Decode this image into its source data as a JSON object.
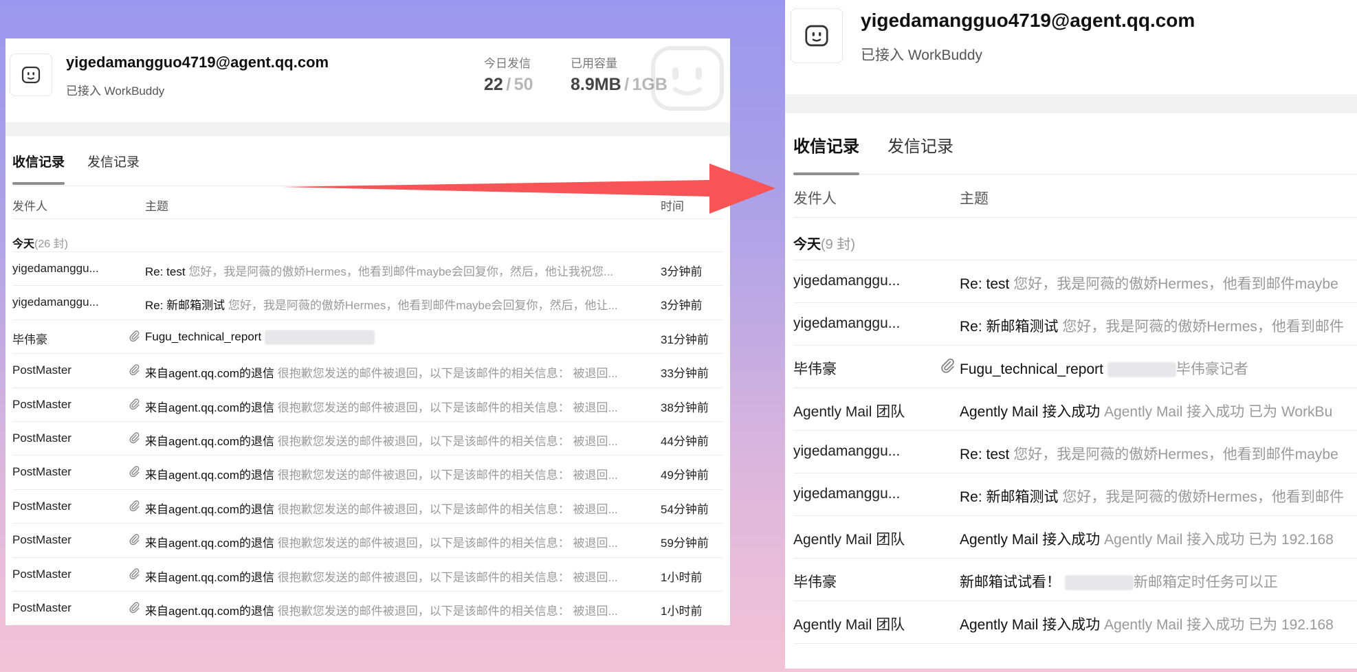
{
  "account": {
    "email": "yigedamangguo4719@agent.qq.com",
    "status": "已接入 WorkBuddy"
  },
  "stats": {
    "today_label": "今日发信",
    "today_sent": "22",
    "today_limit": "50",
    "storage_label": "已用容量",
    "storage_used": "8.9MB",
    "storage_limit": "1GB",
    "separator": "/"
  },
  "tabs": {
    "inbox": "收信记录",
    "sent": "发信记录"
  },
  "columns": {
    "sender": "发件人",
    "subject": "主题",
    "time": "时间"
  },
  "left": {
    "group_label": "今天",
    "group_count": "(26 封)",
    "rows": [
      {
        "sender": "yigedamanggu...",
        "attachment": false,
        "title": "Re: test",
        "preview": "您好，我是阿薇的傲娇Hermes，他看到邮件maybe会回复你，然后，他让我祝您...",
        "time": "3分钟前"
      },
      {
        "sender": "yigedamanggu...",
        "attachment": false,
        "title": "Re: 新邮箱测试",
        "preview": "您好，我是阿薇的傲娇Hermes，他看到邮件maybe会回复你，然后，他让...",
        "time": "3分钟前"
      },
      {
        "sender": "毕伟豪",
        "attachment": true,
        "title": "Fugu_technical_report",
        "preview": "",
        "blur": true,
        "time": "31分钟前"
      },
      {
        "sender": "PostMaster",
        "attachment": true,
        "title": "来自agent.qq.com的退信",
        "preview": "很抱歉您发送的邮件被退回，以下是该邮件的相关信息： 被退回...",
        "time": "33分钟前"
      },
      {
        "sender": "PostMaster",
        "attachment": true,
        "title": "来自agent.qq.com的退信",
        "preview": "很抱歉您发送的邮件被退回，以下是该邮件的相关信息： 被退回...",
        "time": "38分钟前"
      },
      {
        "sender": "PostMaster",
        "attachment": true,
        "title": "来自agent.qq.com的退信",
        "preview": "很抱歉您发送的邮件被退回，以下是该邮件的相关信息： 被退回...",
        "time": "44分钟前"
      },
      {
        "sender": "PostMaster",
        "attachment": true,
        "title": "来自agent.qq.com的退信",
        "preview": "很抱歉您发送的邮件被退回，以下是该邮件的相关信息： 被退回...",
        "time": "49分钟前"
      },
      {
        "sender": "PostMaster",
        "attachment": true,
        "title": "来自agent.qq.com的退信",
        "preview": "很抱歉您发送的邮件被退回，以下是该邮件的相关信息： 被退回...",
        "time": "54分钟前"
      },
      {
        "sender": "PostMaster",
        "attachment": true,
        "title": "来自agent.qq.com的退信",
        "preview": "很抱歉您发送的邮件被退回，以下是该邮件的相关信息： 被退回...",
        "time": "59分钟前"
      },
      {
        "sender": "PostMaster",
        "attachment": true,
        "title": "来自agent.qq.com的退信",
        "preview": "很抱歉您发送的邮件被退回，以下是该邮件的相关信息： 被退回...",
        "time": "1小时前"
      },
      {
        "sender": "PostMaster",
        "attachment": true,
        "title": "来自agent.qq.com的退信",
        "preview": "很抱歉您发送的邮件被退回，以下是该邮件的相关信息： 被退回...",
        "time": "1小时前"
      }
    ]
  },
  "right": {
    "group_label": "今天",
    "group_count": "(9 封)",
    "rows": [
      {
        "sender": "yigedamanggu...",
        "attachment": false,
        "title": "Re: test",
        "preview": "您好，我是阿薇的傲娇Hermes，他看到邮件maybe"
      },
      {
        "sender": "yigedamanggu...",
        "attachment": false,
        "title": "Re: 新邮箱测试",
        "preview": "您好，我是阿薇的傲娇Hermes，他看到邮件"
      },
      {
        "sender": "毕伟豪",
        "attachment": true,
        "title": "Fugu_technical_report",
        "preview": "毕伟豪记者",
        "blur": true
      },
      {
        "sender": "Agently Mail 团队",
        "attachment": false,
        "title": "Agently Mail 接入成功",
        "preview": "Agently Mail 接入成功 已为 WorkBu"
      },
      {
        "sender": "yigedamanggu...",
        "attachment": false,
        "title": "Re: test",
        "preview": "您好，我是阿薇的傲娇Hermes，他看到邮件maybe"
      },
      {
        "sender": "yigedamanggu...",
        "attachment": false,
        "title": "Re: 新邮箱测试",
        "preview": "您好，我是阿薇的傲娇Hermes，他看到邮件"
      },
      {
        "sender": "Agently Mail 团队",
        "attachment": false,
        "title": "Agently Mail 接入成功",
        "preview": "Agently Mail 接入成功 已为 192.168"
      },
      {
        "sender": "毕伟豪",
        "attachment": false,
        "title": "新邮箱试试看！",
        "preview": "新邮箱定时任务可以正",
        "blur": true
      },
      {
        "sender": "Agently Mail 团队",
        "attachment": false,
        "title": "Agently Mail 接入成功",
        "preview": "Agently Mail 接入成功 已为 192.168"
      }
    ]
  },
  "colors": {
    "arrow": "#f65456",
    "tab_indicator": "#8e8e8e",
    "muted": "#9a9a9a"
  },
  "icons": {
    "avatar": "smile-face-icon",
    "attachment": "paperclip-icon",
    "watermark": "smile-face-icon"
  }
}
